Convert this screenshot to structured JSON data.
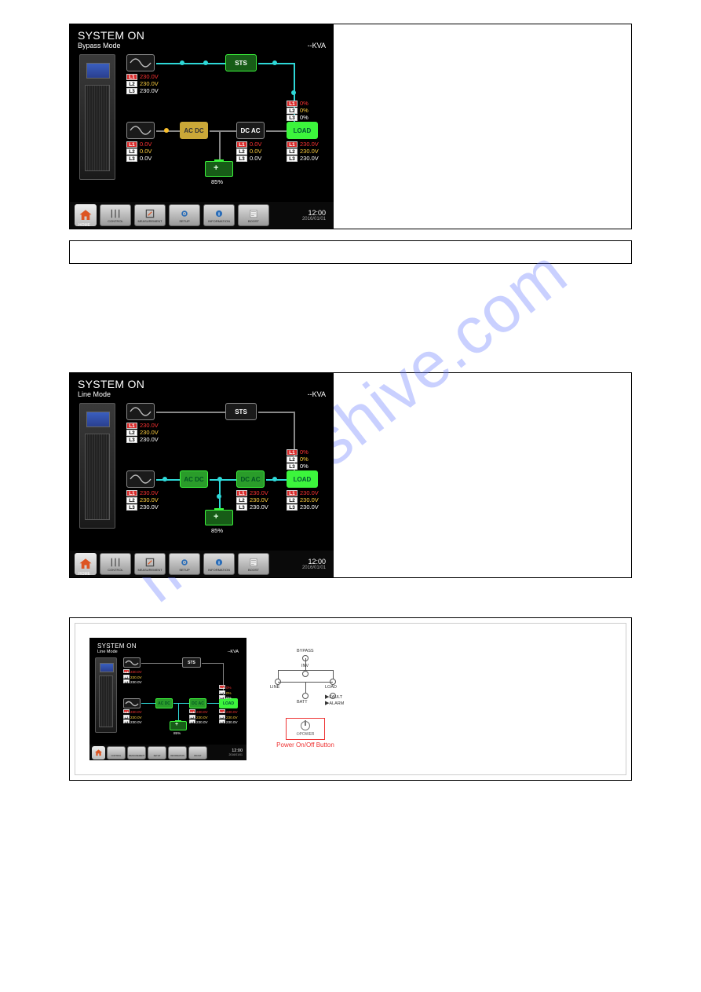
{
  "watermark": "manualshive.com",
  "sections": [
    {
      "title": "SYSTEM ON",
      "mode": "Bypass Mode",
      "kva": "--KVA",
      "sts_label": "STS",
      "acdc_label": "AC  DC",
      "dcac_label": "DC  AC",
      "load_label": "LOAD",
      "batt_pct": "85%",
      "bypass_v": {
        "L1": "230.0V",
        "L2": "230.0V",
        "L3": "230.0V"
      },
      "line_v": {
        "L1": "0.0V",
        "L2": "0.0V",
        "L3": "0.0V"
      },
      "inv_v": {
        "L1": "0.0V",
        "L2": "0.0V",
        "L3": "0.0V"
      },
      "load_pct": {
        "L1": "0%",
        "L2": "0%",
        "L3": "0%"
      },
      "out_v": {
        "L1": "230.0V",
        "L2": "230.0V",
        "L3": "230.0V"
      },
      "nav": {
        "home_label": "HOME",
        "items": [
          "CONTROL",
          "MEASUREMENT",
          "SETUP",
          "INFORMATION",
          "BOOST"
        ],
        "time": "12:00",
        "date": "2016/01/01"
      }
    },
    {
      "title": "SYSTEM ON",
      "mode": "Line Mode",
      "kva": "--KVA",
      "sts_label": "STS",
      "acdc_label": "AC  DC",
      "dcac_label": "DC  AC",
      "load_label": "LOAD",
      "batt_pct": "85%",
      "bypass_v": {
        "L1": "230.0V",
        "L2": "230.0V",
        "L3": "230.0V"
      },
      "line_v": {
        "L1": "230.0V",
        "L2": "230.0V",
        "L3": "230.0V"
      },
      "inv_v": {
        "L1": "230.0V",
        "L2": "230.0V",
        "L3": "230.0V"
      },
      "load_pct": {
        "L1": "0%",
        "L2": "0%",
        "L3": "0%"
      },
      "out_v": {
        "L1": "230.0V",
        "L2": "230.0V",
        "L3": "230.0V"
      },
      "nav": {
        "home_label": "HOME",
        "items": [
          "CONTROL",
          "MEASUREMENT",
          "SETUP",
          "INFORMATION",
          "BOOST"
        ],
        "time": "12:00",
        "date": "2016/01/01"
      }
    },
    {
      "title": "SYSTEM ON",
      "mode": "Line Mode",
      "kva": "--KVA",
      "sts_label": "STS",
      "acdc_label": "AC DC",
      "dcac_label": "DC AC",
      "load_label": "LOAD",
      "batt_pct": "85%",
      "bypass_v": {
        "L1": "230.0V",
        "L2": "230.0V",
        "L3": "230.0V"
      },
      "line_v": {
        "L1": "230.0V",
        "L2": "230.0V",
        "L3": "230.0V"
      },
      "inv_v": {
        "L1": "230.0V",
        "L2": "230.0V",
        "L3": "230.0V"
      },
      "load_pct": {
        "L1": "0%",
        "L2": "0%",
        "L3": "0%"
      },
      "out_v": {
        "L1": "230.0V",
        "L2": "230.0V",
        "L3": "230.0V"
      },
      "nav": {
        "home_label": "HOME",
        "items": [
          "CONTROL",
          "MEASUREMENT",
          "SETUP",
          "INFORMATION",
          "BOOST"
        ],
        "time": "12:00",
        "date": "2016/01/01"
      },
      "circuit": {
        "bypass": "BYPASS",
        "inv": "INV",
        "line": "LINE",
        "load": "LOAD",
        "batt": "BATT",
        "fault": "FAULT",
        "alarm": "ALARM",
        "power_label": "POWER",
        "caption": "Power On/Off Button"
      }
    }
  ]
}
